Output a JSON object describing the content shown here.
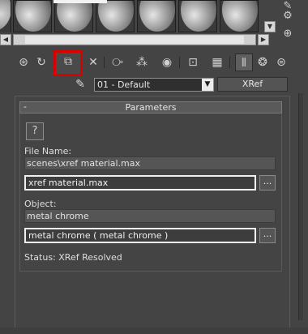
{
  "sample_slots": {
    "slots": [
      "sample-slot",
      "sample-slot",
      "sample-slot",
      "sample-slot",
      "sample-slot",
      "sample-slot"
    ],
    "scroll_up": "▲",
    "scroll_down": "▼",
    "scroll_left": "◀",
    "scroll_right": "▶"
  },
  "toolbar": {
    "buttons": [
      {
        "name": "get-material-icon",
        "glyph": "⊛"
      },
      {
        "name": "put-to-scene-icon",
        "glyph": "↻"
      },
      {
        "name": "assign-to-selection-icon",
        "glyph": "⧉"
      },
      {
        "name": "reset-map-icon",
        "glyph": "✕"
      },
      {
        "name": "make-unique-icon",
        "glyph": "⧂"
      },
      {
        "name": "put-to-library-icon",
        "glyph": "⁂"
      },
      {
        "name": "material-id-channel-icon",
        "glyph": "◉"
      },
      {
        "name": "show-map-in-viewport-icon",
        "glyph": "⊡"
      },
      {
        "name": "show-end-result-icon",
        "glyph": "▦"
      },
      {
        "name": "go-to-parent-icon",
        "glyph": "⫴"
      },
      {
        "name": "go-forward-to-sibling-icon",
        "glyph": "❂"
      },
      {
        "name": "options-icon",
        "glyph": "⊜"
      }
    ],
    "highlighted_button": "assign-to-selection-icon",
    "highlight_color": "#d90000"
  },
  "material": {
    "name": "01 - Default",
    "type_button": "XRef"
  },
  "parameters": {
    "title": "Parameters",
    "collapse_glyph": "-",
    "help_glyph": "?",
    "file_name_label": "File Name:",
    "file_name_value": "scenes\\xref material.max",
    "file_button": "xref material.max",
    "browse_label": "...",
    "object_label": "Object:",
    "object_value": "metal chrome",
    "object_button": "metal chrome ( metal chrome )",
    "status": "Status: XRef Resolved"
  },
  "side_icons": {
    "top": "⚙",
    "middle": "✎",
    "bottom": "⊕"
  }
}
